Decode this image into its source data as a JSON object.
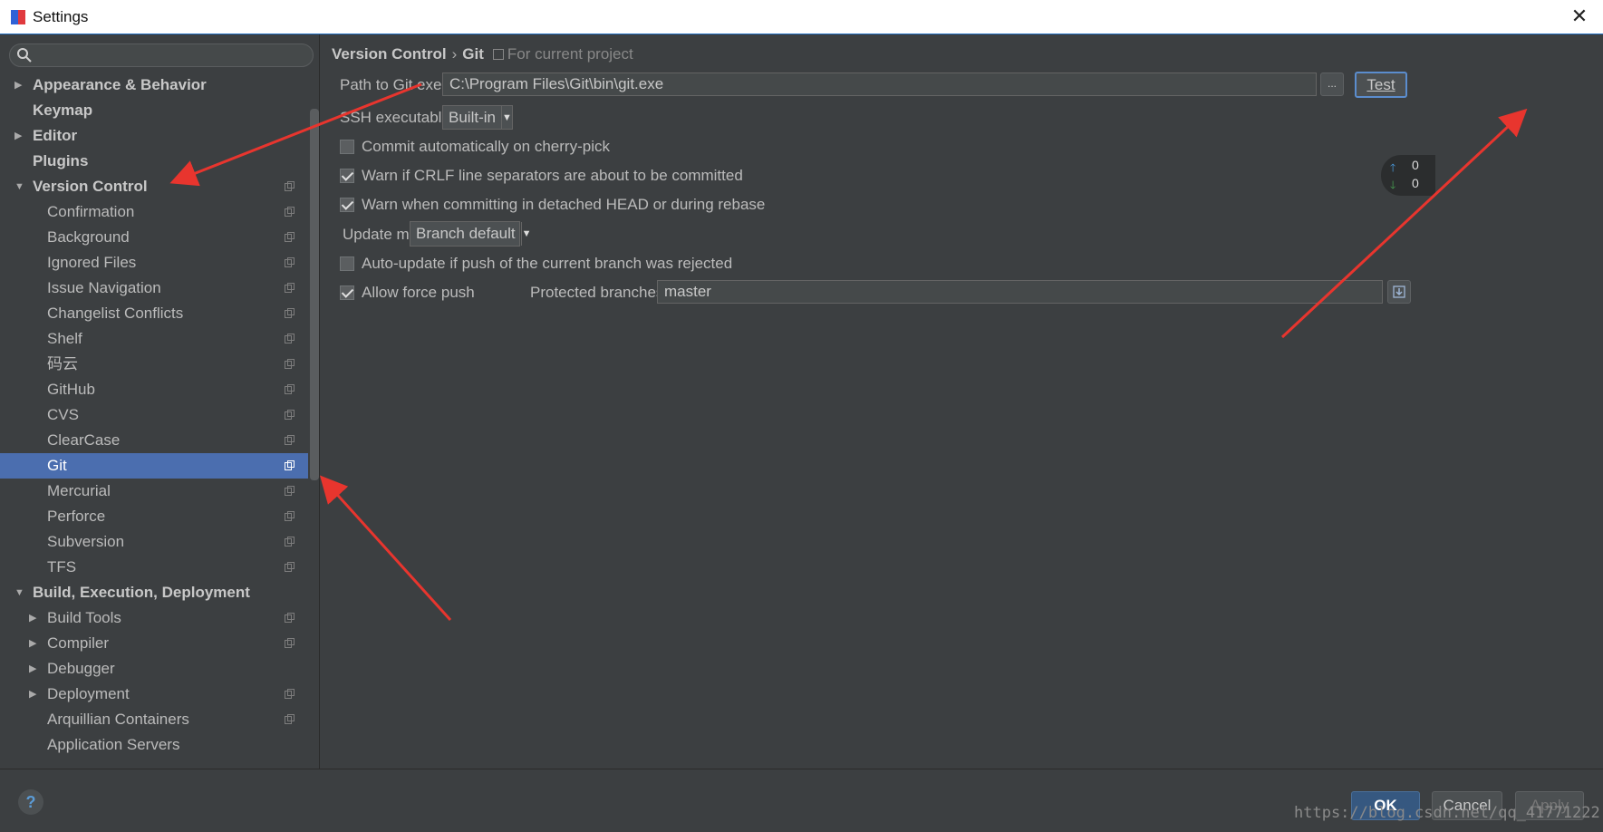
{
  "window": {
    "title": "Settings",
    "colors": {
      "accent": "#4b6eaf",
      "background": "#3c3f41",
      "arrow": "#e8352e"
    }
  },
  "search": {
    "placeholder": "",
    "value": ""
  },
  "tree": [
    {
      "label": "Appearance & Behavior",
      "level": 0,
      "bold": true,
      "arrow": "right",
      "proj": false,
      "selected": false
    },
    {
      "label": "Keymap",
      "level": 0,
      "bold": true,
      "arrow": "none",
      "proj": false,
      "selected": false
    },
    {
      "label": "Editor",
      "level": 0,
      "bold": true,
      "arrow": "right",
      "proj": false,
      "selected": false
    },
    {
      "label": "Plugins",
      "level": 0,
      "bold": true,
      "arrow": "none",
      "proj": false,
      "selected": false
    },
    {
      "label": "Version Control",
      "level": 0,
      "bold": true,
      "arrow": "down",
      "proj": true,
      "selected": false
    },
    {
      "label": "Confirmation",
      "level": 1,
      "bold": false,
      "arrow": "none",
      "proj": true,
      "selected": false
    },
    {
      "label": "Background",
      "level": 1,
      "bold": false,
      "arrow": "none",
      "proj": true,
      "selected": false
    },
    {
      "label": "Ignored Files",
      "level": 1,
      "bold": false,
      "arrow": "none",
      "proj": true,
      "selected": false
    },
    {
      "label": "Issue Navigation",
      "level": 1,
      "bold": false,
      "arrow": "none",
      "proj": true,
      "selected": false
    },
    {
      "label": "Changelist Conflicts",
      "level": 1,
      "bold": false,
      "arrow": "none",
      "proj": true,
      "selected": false
    },
    {
      "label": "Shelf",
      "level": 1,
      "bold": false,
      "arrow": "none",
      "proj": true,
      "selected": false
    },
    {
      "label": "码云",
      "level": 1,
      "bold": false,
      "arrow": "none",
      "proj": true,
      "selected": false
    },
    {
      "label": "GitHub",
      "level": 1,
      "bold": false,
      "arrow": "none",
      "proj": true,
      "selected": false
    },
    {
      "label": "CVS",
      "level": 1,
      "bold": false,
      "arrow": "none",
      "proj": true,
      "selected": false
    },
    {
      "label": "ClearCase",
      "level": 1,
      "bold": false,
      "arrow": "none",
      "proj": true,
      "selected": false
    },
    {
      "label": "Git",
      "level": 1,
      "bold": false,
      "arrow": "none",
      "proj": true,
      "selected": true
    },
    {
      "label": "Mercurial",
      "level": 1,
      "bold": false,
      "arrow": "none",
      "proj": true,
      "selected": false
    },
    {
      "label": "Perforce",
      "level": 1,
      "bold": false,
      "arrow": "none",
      "proj": true,
      "selected": false
    },
    {
      "label": "Subversion",
      "level": 1,
      "bold": false,
      "arrow": "none",
      "proj": true,
      "selected": false
    },
    {
      "label": "TFS",
      "level": 1,
      "bold": false,
      "arrow": "none",
      "proj": true,
      "selected": false
    },
    {
      "label": "Build, Execution, Deployment",
      "level": 0,
      "bold": true,
      "arrow": "down",
      "proj": false,
      "selected": false
    },
    {
      "label": "Build Tools",
      "level": 1,
      "bold": false,
      "arrow": "right",
      "proj": true,
      "selected": false
    },
    {
      "label": "Compiler",
      "level": 1,
      "bold": false,
      "arrow": "right",
      "proj": true,
      "selected": false
    },
    {
      "label": "Debugger",
      "level": 1,
      "bold": false,
      "arrow": "right",
      "proj": false,
      "selected": false
    },
    {
      "label": "Deployment",
      "level": 1,
      "bold": false,
      "arrow": "right",
      "proj": true,
      "selected": false
    },
    {
      "label": "Arquillian Containers",
      "level": 1,
      "bold": false,
      "arrow": "none",
      "proj": true,
      "selected": false
    },
    {
      "label": "Application Servers",
      "level": 1,
      "bold": false,
      "arrow": "none",
      "proj": false,
      "selected": false
    }
  ],
  "breadcrumb": {
    "parent": "Version Control",
    "separator": "›",
    "current": "Git",
    "scope": "For current project"
  },
  "git": {
    "path_label": "Path to Git executable:",
    "path_value": "C:\\Program Files\\Git\\bin\\git.exe",
    "browse_label": "...",
    "test_label": "Test",
    "ssh_label": "SSH executable:",
    "ssh_value": "Built-in",
    "cherry_pick_label": "Commit automatically on cherry-pick",
    "cherry_pick_checked": false,
    "crlf_label": "Warn if CRLF line separators are about to be committed",
    "crlf_checked": true,
    "detached_label": "Warn when committing in detached HEAD or during rebase",
    "detached_checked": true,
    "update_method_label": "Update method:",
    "update_method_value": "Branch default",
    "auto_update_label": "Auto-update if push of the current branch was rejected",
    "auto_update_checked": false,
    "force_push_label": "Allow force push",
    "force_push_checked": true,
    "protected_label": "Protected branches:",
    "protected_value": "master"
  },
  "widget": {
    "up_count": "0",
    "down_count": "0"
  },
  "footer": {
    "help": "?",
    "ok": "OK",
    "cancel": "Cancel",
    "apply": "Apply"
  },
  "watermark": "https://blog.csdn.net/qq_41771222"
}
